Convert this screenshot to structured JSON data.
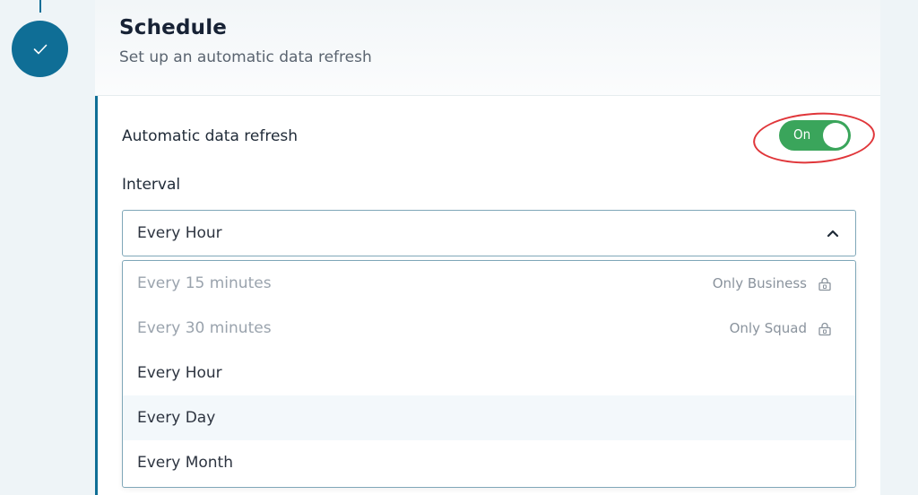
{
  "stepper": {
    "icon": "check-icon",
    "color": "#0f6e96"
  },
  "header": {
    "title": "Schedule",
    "subtitle": "Set up an automatic data refresh"
  },
  "refresh": {
    "label": "Automatic data refresh",
    "toggle_text": "On",
    "enabled": true,
    "toggle_color": "#3aa55b"
  },
  "interval": {
    "label": "Interval",
    "selected": "Every Hour",
    "options": [
      {
        "label": "Every 15 minutes",
        "note": "Only Business",
        "icon": "lock-icon",
        "disabled": true
      },
      {
        "label": "Every 30 minutes",
        "note": "Only Squad",
        "icon": "lock-icon",
        "disabled": true
      },
      {
        "label": "Every Hour",
        "note": "",
        "disabled": false
      },
      {
        "label": "Every Day",
        "note": "",
        "disabled": false
      },
      {
        "label": "Every Month",
        "note": "",
        "disabled": false
      }
    ]
  },
  "colors": {
    "accent": "#0f6e96",
    "annotation_ring": "#e0363a"
  }
}
